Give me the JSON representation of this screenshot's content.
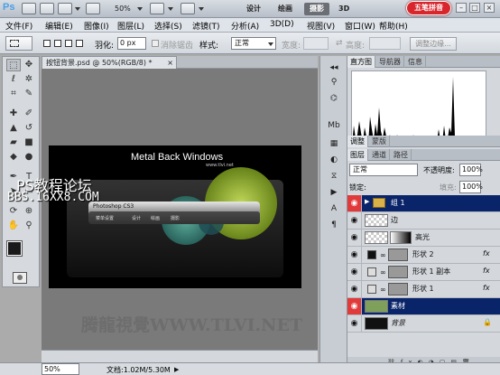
{
  "app": {
    "logo": "Ps",
    "zoom": "50%",
    "workspaces": [
      "设计",
      "绘画",
      "摄影",
      "3D"
    ],
    "active_workspace": "摄影",
    "badge": "五笔拼音"
  },
  "menu": [
    "文件(F)",
    "编辑(E)",
    "图像(I)",
    "图层(L)",
    "选择(S)",
    "滤镜(T)",
    "分析(A)",
    "3D(D)",
    "视图(V)",
    "窗口(W)",
    "帮助(H)"
  ],
  "options": {
    "feather_label": "羽化:",
    "feather_value": "0 px",
    "antialias_label": "消除锯齿",
    "style_label": "样式:",
    "style_value": "正常",
    "width_label": "宽度:",
    "height_label": "高度:",
    "refine_button": "调整边缘..."
  },
  "document": {
    "tab_title": "按钮背景.psd @ 50%(RGB/8) *",
    "zoom_status": "50%",
    "doc_status": "文档:1.02M/5.30M"
  },
  "artwork": {
    "title": "Metal Back Windows",
    "site": "www.tlvi.net",
    "bar_title": "Photoshop CS3",
    "bar_menu": [
      "菜单设置",
      "设计",
      "绘画",
      "摄影"
    ]
  },
  "watermarks": {
    "forum_cn": "PS教程论坛",
    "forum_url": "BBS.16XX8.COM",
    "bottom": "腾龍視覺WWW.TLVI.NET"
  },
  "histogram": {
    "tabs": [
      "直方图",
      "导航器",
      "信息"
    ]
  },
  "adjust_tabs": [
    "调整",
    "蒙版"
  ],
  "layers_panel": {
    "tabs": [
      "图层",
      "通道",
      "路径"
    ],
    "blend_mode": "正常",
    "opacity_label": "不透明度:",
    "opacity_value": "100%",
    "lock_label": "锁定:",
    "fill_label": "填充:",
    "fill_value": "100%",
    "layers": [
      {
        "name": "组 1",
        "kind": "group",
        "selected": true,
        "eye_red": true
      },
      {
        "name": "边",
        "kind": "raster"
      },
      {
        "name": "高光",
        "kind": "raster"
      },
      {
        "name": "形状 2",
        "kind": "shape",
        "fx": "fx"
      },
      {
        "name": "形状 1 副本",
        "kind": "shape",
        "fx": "fx"
      },
      {
        "name": "形状 1",
        "kind": "shape",
        "fx": "fx"
      },
      {
        "name": "素材",
        "kind": "raster",
        "selected": true,
        "eye_red": true
      },
      {
        "name": "背景",
        "kind": "background"
      }
    ]
  },
  "colors": {
    "selected_row": "#0a246a",
    "eye_red": "#e03a3a"
  }
}
